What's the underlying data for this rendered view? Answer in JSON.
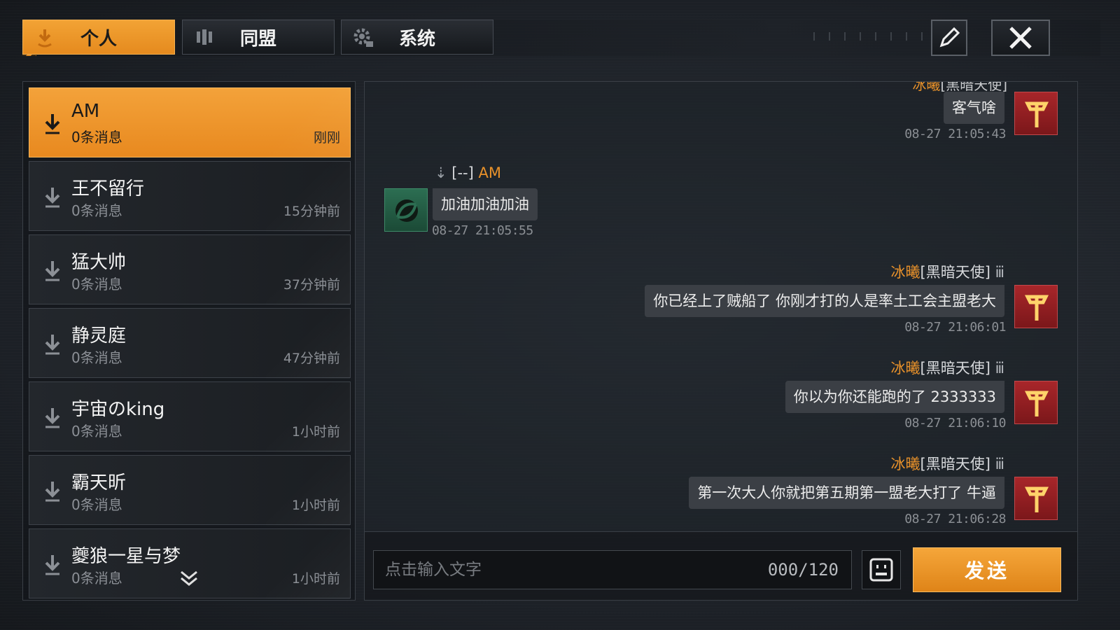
{
  "tabs": [
    {
      "label": "个人",
      "icon": "person-down-icon",
      "active": true
    },
    {
      "label": "同盟",
      "icon": "alliance-icon",
      "active": false
    },
    {
      "label": "系统",
      "icon": "gear-icon",
      "active": false
    }
  ],
  "toolbar": {
    "edit_icon": "pencil-icon",
    "close_icon": "close-icon"
  },
  "contacts": [
    {
      "name": "AM",
      "messages": "0条消息",
      "time": "刚刚",
      "active": true
    },
    {
      "name": "王不留行",
      "messages": "0条消息",
      "time": "15分钟前",
      "active": false
    },
    {
      "name": "猛大帅",
      "messages": "0条消息",
      "time": "37分钟前",
      "active": false
    },
    {
      "name": "静灵庭",
      "messages": "0条消息",
      "time": "47分钟前",
      "active": false
    },
    {
      "name": "宇宙のking",
      "messages": "0条消息",
      "time": "1小时前",
      "active": false
    },
    {
      "name": "霸天昕",
      "messages": "0条消息",
      "time": "1小时前",
      "active": false
    },
    {
      "name": "夔狼一星与梦",
      "messages": "0条消息",
      "time": "1小时前",
      "active": false
    }
  ],
  "chat": {
    "partial_header": {
      "name": "冰曦",
      "tag": "[黑暗天使]"
    },
    "messages": [
      {
        "side": "right",
        "text": "客气啥",
        "time": "08-27 21:05:43",
        "avatar": "red"
      },
      {
        "side": "left",
        "tag": "[--]",
        "name": "AM",
        "text": "加油加油加油",
        "time": "08-27 21:05:55",
        "avatar": "green"
      },
      {
        "side": "right",
        "name": "冰曦",
        "tag": "[黑暗天使]",
        "text": "你已经上了贼船了 你刚才打的人是率土工会主盟老大",
        "time": "08-27 21:06:01",
        "avatar": "red"
      },
      {
        "side": "right",
        "name": "冰曦",
        "tag": "[黑暗天使]",
        "text": "你以为你还能跑的了 2333333",
        "time": "08-27 21:06:10",
        "avatar": "red"
      },
      {
        "side": "right",
        "name": "冰曦",
        "tag": "[黑暗天使]",
        "text": "第一次大人你就把第五期第一盟老大打了 牛逼",
        "time": "08-27 21:06:28",
        "avatar": "red"
      }
    ]
  },
  "input": {
    "placeholder": "点击输入文字",
    "counter": "000/120",
    "emoji_icon": "emoji-icon",
    "send_label": "发送"
  },
  "colors": {
    "accent": "#e8912a",
    "avatar_red": "#a8262a",
    "avatar_green": "#2c6e52"
  }
}
